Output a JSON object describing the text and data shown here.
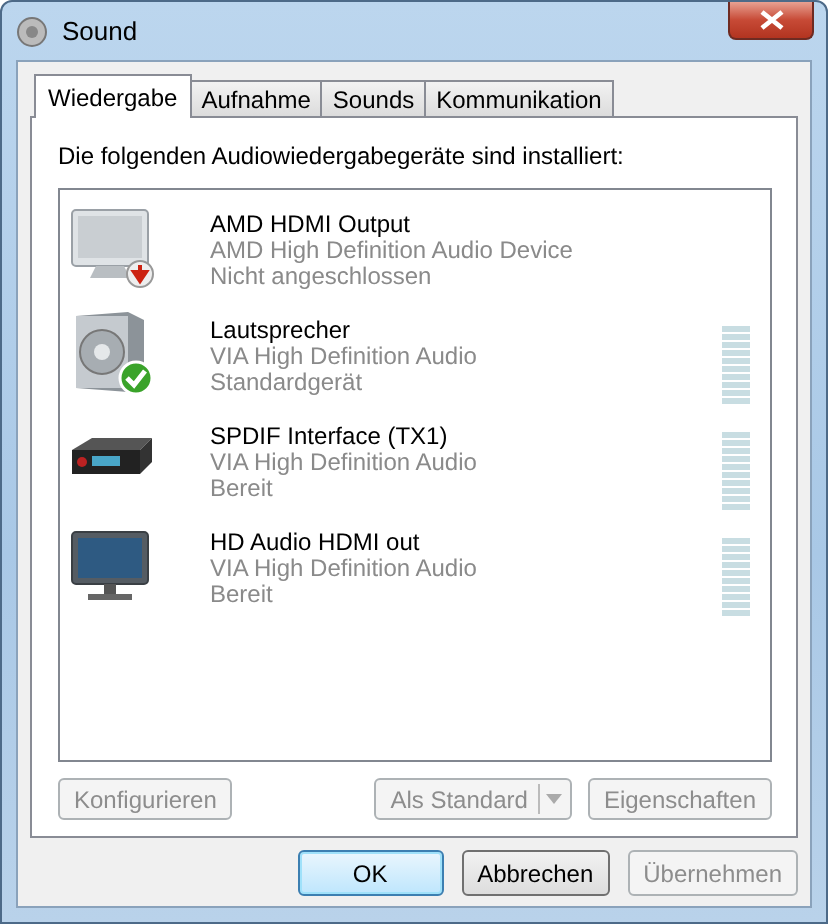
{
  "window": {
    "title": "Sound"
  },
  "tabs": [
    {
      "label": "Wiedergabe",
      "selected": true
    },
    {
      "label": "Aufnahme",
      "selected": false
    },
    {
      "label": "Sounds",
      "selected": false
    },
    {
      "label": "Kommunikation",
      "selected": false
    }
  ],
  "heading": "Die folgenden Audiowiedergabegeräte sind installiert:",
  "devices": [
    {
      "name": "AMD HDMI Output",
      "driver": "AMD High Definition Audio Device",
      "status": "Nicht angeschlossen",
      "kind": "monitor",
      "badge": {
        "kind": "disconnected"
      }
    },
    {
      "name": "Lautsprecher",
      "driver": "VIA High Definition Audio",
      "status": "Standardgerät",
      "kind": "speaker",
      "badge": {
        "kind": "default"
      },
      "level": 0
    },
    {
      "name": "SPDIF Interface (TX1)",
      "driver": "VIA High Definition Audio",
      "status": "Bereit",
      "kind": "receiver",
      "level": 0
    },
    {
      "name": "HD Audio HDMI out",
      "driver": "VIA High Definition Audio",
      "status": "Bereit",
      "kind": "screen",
      "level": 0
    }
  ],
  "device_buttons": [
    {
      "label": "Konfigurieren",
      "disabled": true,
      "kind": "plain"
    },
    {
      "label": "Als Standard",
      "disabled": true,
      "kind": "split"
    },
    {
      "label": "Eigenschaften",
      "disabled": true,
      "kind": "plain"
    }
  ],
  "dialog_buttons": [
    {
      "label": "OK",
      "disabled": false,
      "default": true
    },
    {
      "label": "Abbrechen",
      "disabled": false,
      "default": false
    },
    {
      "label": "Übernehmen",
      "disabled": true,
      "default": false
    }
  ]
}
